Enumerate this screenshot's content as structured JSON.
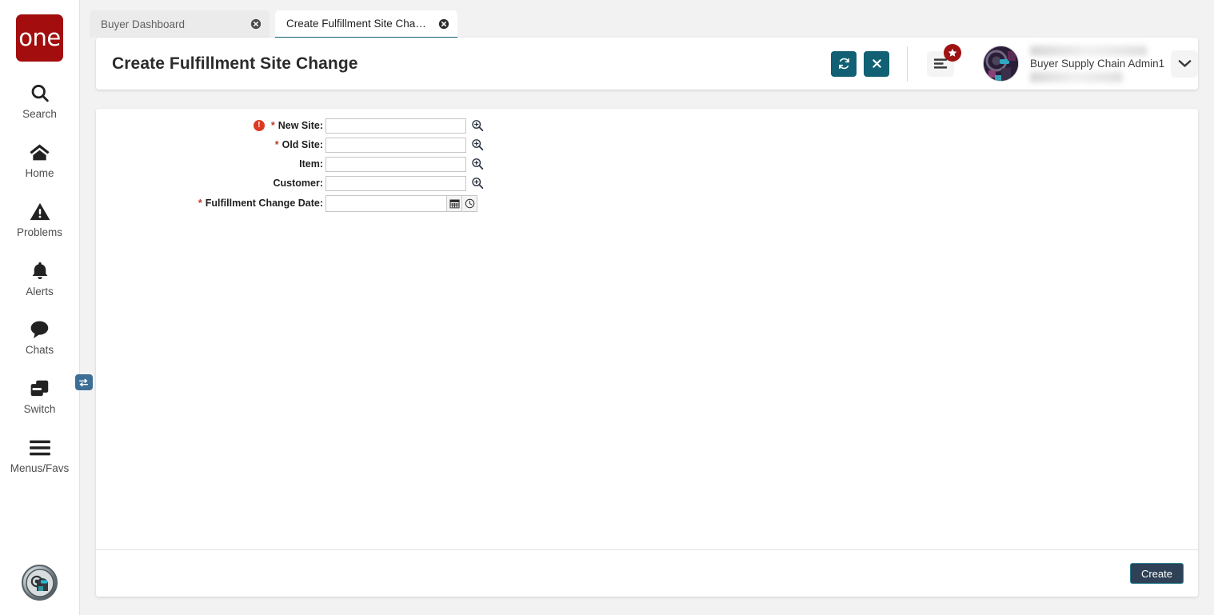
{
  "brand": {
    "logo_text": "one",
    "logo_color": "#a30d0d"
  },
  "sidebar": {
    "items": [
      {
        "label": "Search",
        "icon": "search-icon"
      },
      {
        "label": "Home",
        "icon": "home-icon"
      },
      {
        "label": "Problems",
        "icon": "warning-triangle-icon"
      },
      {
        "label": "Alerts",
        "icon": "bell-icon"
      },
      {
        "label": "Chats",
        "icon": "chat-bubble-icon"
      },
      {
        "label": "Switch",
        "icon": "switch-windows-icon",
        "badge_icon": "exchange-arrows-icon"
      },
      {
        "label": "Menus/Favs",
        "icon": "hamburger-icon"
      }
    ],
    "assistant_avatar": "ai-assistant-avatar-icon"
  },
  "tabs": [
    {
      "label": "Buyer Dashboard",
      "active": false,
      "close_icon": "close-circle-icon"
    },
    {
      "label": "Create Fulfillment Site Change",
      "active": true,
      "close_icon": "close-circle-icon"
    }
  ],
  "header": {
    "title": "Create Fulfillment Site Change",
    "refresh_icon": "refresh-icon",
    "close_icon": "close-x-icon",
    "menu_icon": "menu-lines-icon",
    "menu_badge_icon": "star-icon",
    "accent_color": "#116073",
    "badge_color": "#9e1212"
  },
  "user": {
    "role": "Buyer Supply Chain Admin1",
    "avatar_icon": "user-avatar",
    "caret_icon": "chevron-down-icon"
  },
  "form": {
    "fields": [
      {
        "label": "New Site:",
        "required": true,
        "has_error": true,
        "error_icon": "error-exclamation-icon",
        "value": "",
        "placeholder": "",
        "type": "lookup",
        "lookup_icon": "magnifier-plus-icon"
      },
      {
        "label": "Old Site:",
        "required": true,
        "has_error": false,
        "value": "",
        "placeholder": "",
        "type": "lookup",
        "lookup_icon": "magnifier-plus-icon"
      },
      {
        "label": "Item:",
        "required": false,
        "has_error": false,
        "value": "",
        "placeholder": "",
        "type": "lookup",
        "lookup_icon": "magnifier-plus-icon"
      },
      {
        "label": "Customer:",
        "required": false,
        "has_error": false,
        "value": "",
        "placeholder": "",
        "type": "lookup",
        "lookup_icon": "magnifier-plus-icon"
      },
      {
        "label": "Fulfillment Change Date:",
        "required": true,
        "has_error": false,
        "value": "",
        "placeholder": "",
        "type": "datetime",
        "calendar_icon": "calendar-icon",
        "clock_icon": "clock-icon"
      }
    ]
  },
  "footer": {
    "create_label": "Create",
    "create_bg": "#2e4156",
    "create_border": "#2b7f8f"
  }
}
